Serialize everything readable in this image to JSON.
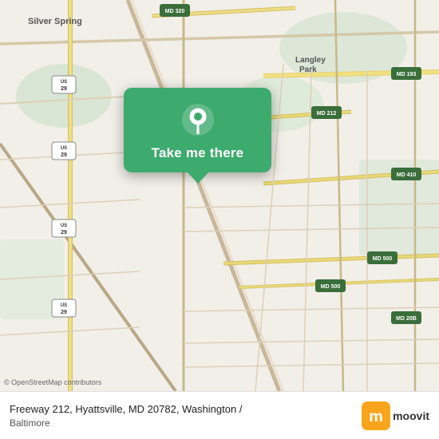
{
  "map": {
    "attribution": "© OpenStreetMap contributors",
    "background_color": "#f2efe9"
  },
  "popup": {
    "button_label": "Take me there",
    "pin_color": "#ffffff"
  },
  "footer": {
    "address_line1": "Freeway 212, Hyattsville, MD 20782, Washington /",
    "address_line2": "Baltimore",
    "logo_text": "moovit"
  },
  "road_labels": {
    "silver_spring": "Silver Spring",
    "langley_park": "Langley\nPark",
    "md_320": "MD 320",
    "md_193": "MD 193",
    "md_212": "MD 212",
    "md_410": "MD 410",
    "md_500_1": "MD 500",
    "md_500_2": "MD 500",
    "md_20b": "MD 20B",
    "us_29_1": "US 29",
    "us_29_2": "US 29",
    "us_29_3": "US 29",
    "us_29_4": "US 29"
  }
}
